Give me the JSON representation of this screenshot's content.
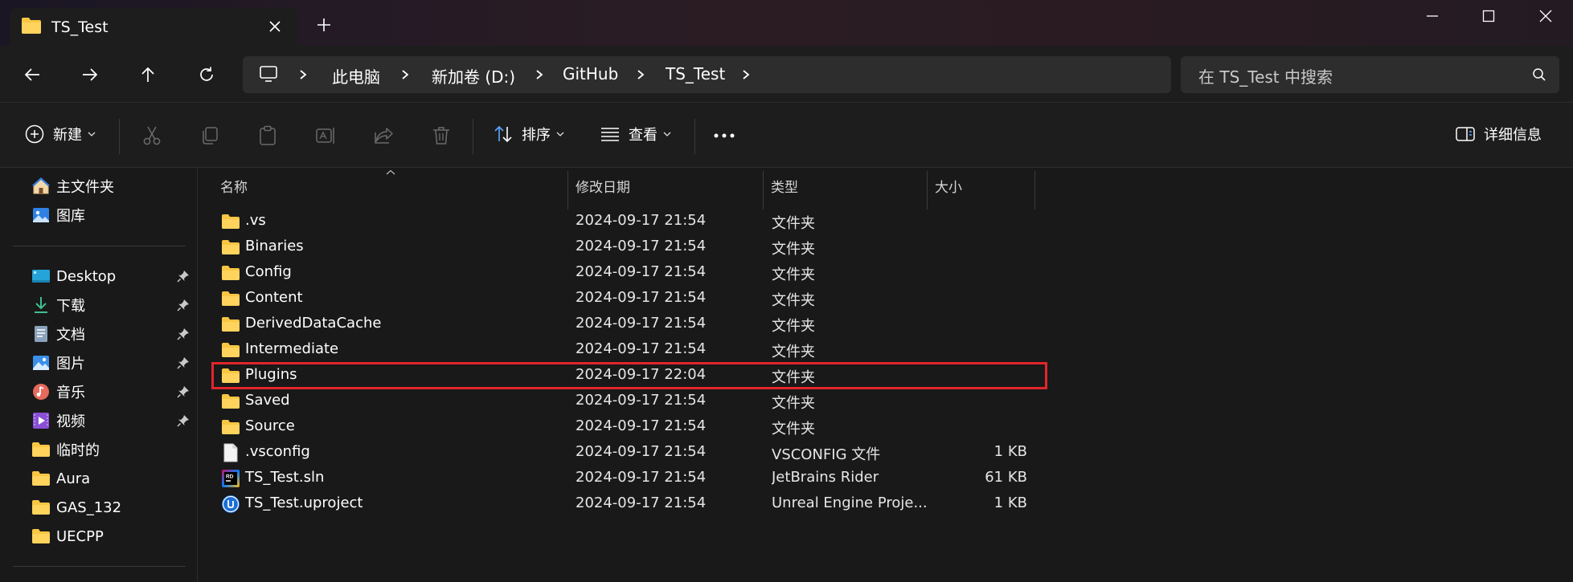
{
  "window": {
    "tab_title": "TS_Test",
    "new_tab_symbol": "+"
  },
  "address_bar": {
    "crumbs": [
      "此电脑",
      "新加卷 (D:)",
      "GitHub",
      "TS_Test"
    ]
  },
  "search": {
    "placeholder": "在 TS_Test 中搜索"
  },
  "toolbar": {
    "new_label": "新建",
    "sort_label": "排序",
    "view_label": "查看",
    "details_label": "详细信息"
  },
  "sidebar": {
    "top_items": [
      {
        "label": "主文件夹",
        "icon": "home-icon"
      },
      {
        "label": "图库",
        "icon": "gallery-icon"
      }
    ],
    "quick_access": [
      {
        "label": "Desktop",
        "icon": "desktop-icon",
        "pinned": true
      },
      {
        "label": "下载",
        "icon": "download-icon",
        "pinned": true
      },
      {
        "label": "文档",
        "icon": "document-icon",
        "pinned": true
      },
      {
        "label": "图片",
        "icon": "pictures-icon",
        "pinned": true
      },
      {
        "label": "音乐",
        "icon": "music-icon",
        "pinned": true
      },
      {
        "label": "视频",
        "icon": "video-icon",
        "pinned": true
      },
      {
        "label": "临时的",
        "icon": "folder-icon",
        "pinned": false
      },
      {
        "label": "Aura",
        "icon": "folder-icon",
        "pinned": false
      },
      {
        "label": "GAS_132",
        "icon": "folder-icon",
        "pinned": false
      },
      {
        "label": "UECPP",
        "icon": "folder-icon",
        "pinned": false
      }
    ]
  },
  "file_list": {
    "columns": {
      "name": "名称",
      "date": "修改日期",
      "type": "类型",
      "size": "大小"
    },
    "sorted_by": "名称",
    "rows": [
      {
        "name": ".vs",
        "date": "2024-09-17 21:54",
        "type": "文件夹",
        "size": "",
        "icon": "folder-icon"
      },
      {
        "name": "Binaries",
        "date": "2024-09-17 21:54",
        "type": "文件夹",
        "size": "",
        "icon": "folder-icon"
      },
      {
        "name": "Config",
        "date": "2024-09-17 21:54",
        "type": "文件夹",
        "size": "",
        "icon": "folder-icon"
      },
      {
        "name": "Content",
        "date": "2024-09-17 21:54",
        "type": "文件夹",
        "size": "",
        "icon": "folder-icon"
      },
      {
        "name": "DerivedDataCache",
        "date": "2024-09-17 21:54",
        "type": "文件夹",
        "size": "",
        "icon": "folder-icon"
      },
      {
        "name": "Intermediate",
        "date": "2024-09-17 21:54",
        "type": "文件夹",
        "size": "",
        "icon": "folder-icon"
      },
      {
        "name": "Plugins",
        "date": "2024-09-17 22:04",
        "type": "文件夹",
        "size": "",
        "icon": "folder-icon",
        "highlighted": true
      },
      {
        "name": "Saved",
        "date": "2024-09-17 21:54",
        "type": "文件夹",
        "size": "",
        "icon": "folder-icon"
      },
      {
        "name": "Source",
        "date": "2024-09-17 21:54",
        "type": "文件夹",
        "size": "",
        "icon": "folder-icon"
      },
      {
        "name": ".vsconfig",
        "date": "2024-09-17 21:54",
        "type": "VSCONFIG 文件",
        "size": "1 KB",
        "icon": "file-icon"
      },
      {
        "name": "TS_Test.sln",
        "date": "2024-09-17 21:54",
        "type": "JetBrains Rider",
        "size": "61 KB",
        "icon": "rider-icon"
      },
      {
        "name": "TS_Test.uproject",
        "date": "2024-09-17 21:54",
        "type": "Unreal Engine Proje...",
        "size": "1 KB",
        "icon": "unreal-icon"
      }
    ]
  },
  "colors": {
    "background": "#191919",
    "highlight_border": "#e0262c",
    "folder_yellow": "#f8c642"
  }
}
